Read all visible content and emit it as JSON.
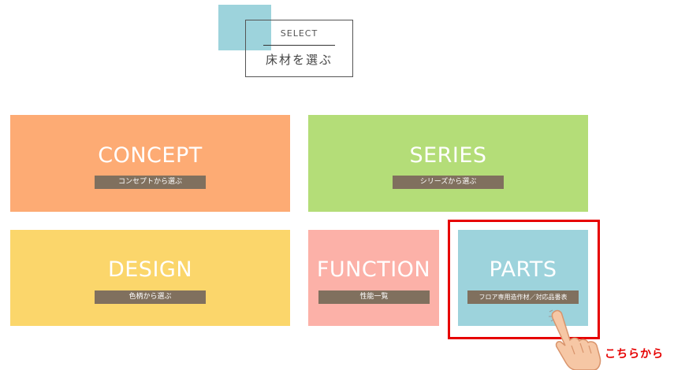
{
  "heading": {
    "en": "SELECT",
    "jp": "床材を選ぶ"
  },
  "cards": {
    "concept": {
      "title": "CONCEPT",
      "sub": "コンセプトから選ぶ"
    },
    "series": {
      "title": "SERIES",
      "sub": "シリーズから選ぶ"
    },
    "design": {
      "title": "DESIGN",
      "sub": "色柄から選ぶ"
    },
    "function": {
      "title": "FUNCTION",
      "sub": "性能一覧"
    },
    "parts": {
      "title": "PARTS",
      "sub": "フロア専用造作材／対応品番表"
    }
  },
  "callout": "こちらから",
  "colors": {
    "concept": "#fdab74",
    "series": "#b4dd78",
    "design": "#fbd66b",
    "function": "#fcb1a8",
    "parts": "#9dd3dc",
    "subtitle_bg": "#80705e",
    "highlight": "#e60000"
  },
  "icons": {
    "pointer": "pointing-hand-icon"
  }
}
